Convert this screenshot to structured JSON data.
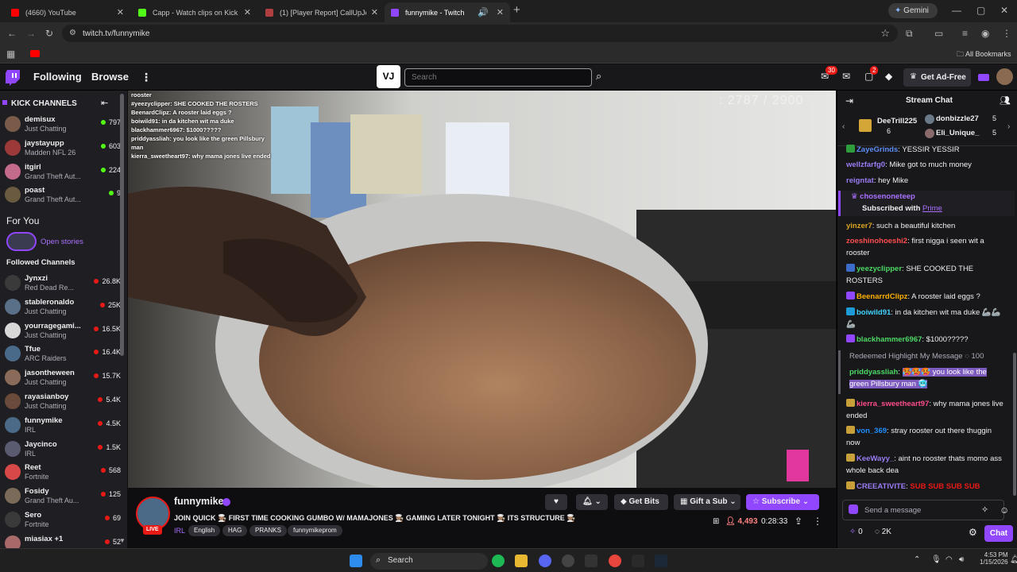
{
  "browser": {
    "tabs": [
      {
        "title": "(4660) YouTube",
        "favicon_color": "#ff0000"
      },
      {
        "title": "Capp - Watch clips on Kick",
        "favicon_color": "#53fc18"
      },
      {
        "title": "(1) [Player Report] CallUpJefe |",
        "favicon_color": "#b04040"
      },
      {
        "title": "funnymike - Twitch",
        "favicon_color": "#9146ff"
      }
    ],
    "new_tab_label": "+",
    "gemini_label": "Gemini",
    "url": "twitch.tv/funnymike",
    "all_bookmarks": "All Bookmarks"
  },
  "twitch_nav": {
    "following": "Following",
    "browse": "Browse",
    "search_placeholder": "Search",
    "notifications_count": "30",
    "whispers_count": "2",
    "get_ad_free": "Get Ad-Free",
    "accent": "#9146ff"
  },
  "sidebar": {
    "kick_header": "KICK CHANNELS",
    "kick_channels": [
      {
        "name": "demisux",
        "game": "Just Chatting",
        "viewers": "797"
      },
      {
        "name": "jaystayupp",
        "game": "Madden NFL 26",
        "viewers": "603"
      },
      {
        "name": "itgirl",
        "game": "Grand Theft Aut...",
        "viewers": "224"
      },
      {
        "name": "poast",
        "game": "Grand Theft Aut...",
        "viewers": "9"
      }
    ],
    "for_you": "For You",
    "open_stories": "Open stories",
    "followed_header": "Followed Channels",
    "followed": [
      {
        "name": "Jynxzi",
        "game": "Red Dead Re...",
        "viewers": "26.8K"
      },
      {
        "name": "stableronaldo",
        "game": "Just Chatting",
        "viewers": "25K"
      },
      {
        "name": "yourragegami...",
        "game": "Just Chatting",
        "viewers": "16.5K"
      },
      {
        "name": "Tfue",
        "game": "ARC Raiders",
        "viewers": "16.4K"
      },
      {
        "name": "jasontheween",
        "game": "Just Chatting",
        "viewers": "15.7K"
      },
      {
        "name": "rayasianboy",
        "game": "Just Chatting",
        "viewers": "5.4K"
      },
      {
        "name": "funnymike",
        "game": "IRL",
        "viewers": "4.5K"
      },
      {
        "name": "Jaycinco",
        "game": "IRL",
        "viewers": "1.5K"
      },
      {
        "name": "Reet",
        "game": "Fortnite",
        "viewers": "568"
      },
      {
        "name": "Fosidy",
        "game": "Grand Theft Au...",
        "viewers": "125"
      },
      {
        "name": "Sero",
        "game": "Fortnite",
        "viewers": "69"
      },
      {
        "name": "miasiax +1",
        "game": "",
        "viewers": "52"
      }
    ]
  },
  "player": {
    "counter": ": 2787 / 2900",
    "overlay_chat": [
      "rooster",
      "#yeezyclipper: SHE COOKED THE ROSTERS",
      "BeenardClipz: A rooster laid eggs ?",
      "boiwild91: in da kitchen wit ma duke",
      "blackhammer6967: $1000?????",
      "priddyassliah: you look like the green Pillsbury man",
      "kierra_sweetheart97: why mama jones live ended"
    ]
  },
  "stream": {
    "channel": "funnymike",
    "live_label": "LIVE",
    "title": "JOIN QUICK 🧑🏽‍🍳 FIRST TIME COOKING GUMBO W/ MAMAJONES 🧑🏽‍🍳 GAMING LATER TONIGHT 🧑🏽‍🍳 ITS STRUCTURE 🧑🏽‍🍳",
    "category": "IRL",
    "tags": [
      "English",
      "HAG",
      "PRANKS",
      "funnymikeprom"
    ],
    "get_bits": "Get Bits",
    "gift_sub": "Gift a Sub",
    "subscribe": "Subscribe",
    "viewers": "4,493",
    "uptime": "0:28:33"
  },
  "chat": {
    "header": "Stream Chat",
    "leaderboard": [
      {
        "name": "DeeTrill225",
        "count": "6"
      },
      {
        "name": "donbizzle27",
        "count": "5"
      },
      {
        "name": "Eli_Unique_",
        "count": "5"
      }
    ],
    "messages": [
      {
        "user": "ZayeGrinds",
        "text": "YESSIR YESSIR",
        "color": "#5c8df6"
      },
      {
        "user": "wellzfarfg0",
        "text": "Mike got to much money",
        "color": "#9a7cf3"
      },
      {
        "user": "reigntat",
        "text": "hey Mike",
        "color": "#9a7cf3"
      },
      {
        "user": "yinzer7",
        "text": "such a beautiful kitchen",
        "color": "#daa520"
      },
      {
        "user": "zoeshinohoeshi2",
        "text": "first nigga i seen wit a rooster",
        "color": "#ff4d4d"
      },
      {
        "user": "yeezyclipper",
        "text": "SHE COOKED THE ROSTERS",
        "color": "#4cd964"
      },
      {
        "user": "BeenarrdClipz",
        "text": "A rooster laid eggs ?",
        "color": "#ffb000"
      },
      {
        "user": "boiwild91",
        "text": "in da kitchen wit ma duke 🦾🦾🦾",
        "color": "#3fd4ff"
      },
      {
        "user": "blackhammer6967",
        "text": "$1000?????",
        "color": "#4cd964"
      },
      {
        "user": "kierra_sweetheart97",
        "text": "why mama jones live ended",
        "color": "#ff4d88"
      },
      {
        "user": "von_369",
        "text": "stray rooster out there thuggin now",
        "color": "#1e90ff"
      },
      {
        "user": "KeeWayy_",
        "text": "aint no rooster thats momo ass whole back dea",
        "color": "#9a7cf3"
      },
      {
        "user": "CREEATIVITE",
        "text": "SUB SUB SUB SUB",
        "color": "#9a7cf3"
      }
    ],
    "sub_notice": {
      "user": "chosenoneteep",
      "text": "Subscribed with",
      "link": "Prime"
    },
    "highlight": {
      "label": "Redeemed Highlight My Message",
      "cost": "100",
      "user": "priddyassliah",
      "text": "🥵🥵🥵 you look like the green Pillsbury man 🥶"
    },
    "input_placeholder": "Send a message",
    "bits_count": "0",
    "points_count": "2K",
    "chat_button": "Chat"
  },
  "taskbar": {
    "search": "Search",
    "time": "4:53 PM",
    "date": "1/15/2026"
  }
}
